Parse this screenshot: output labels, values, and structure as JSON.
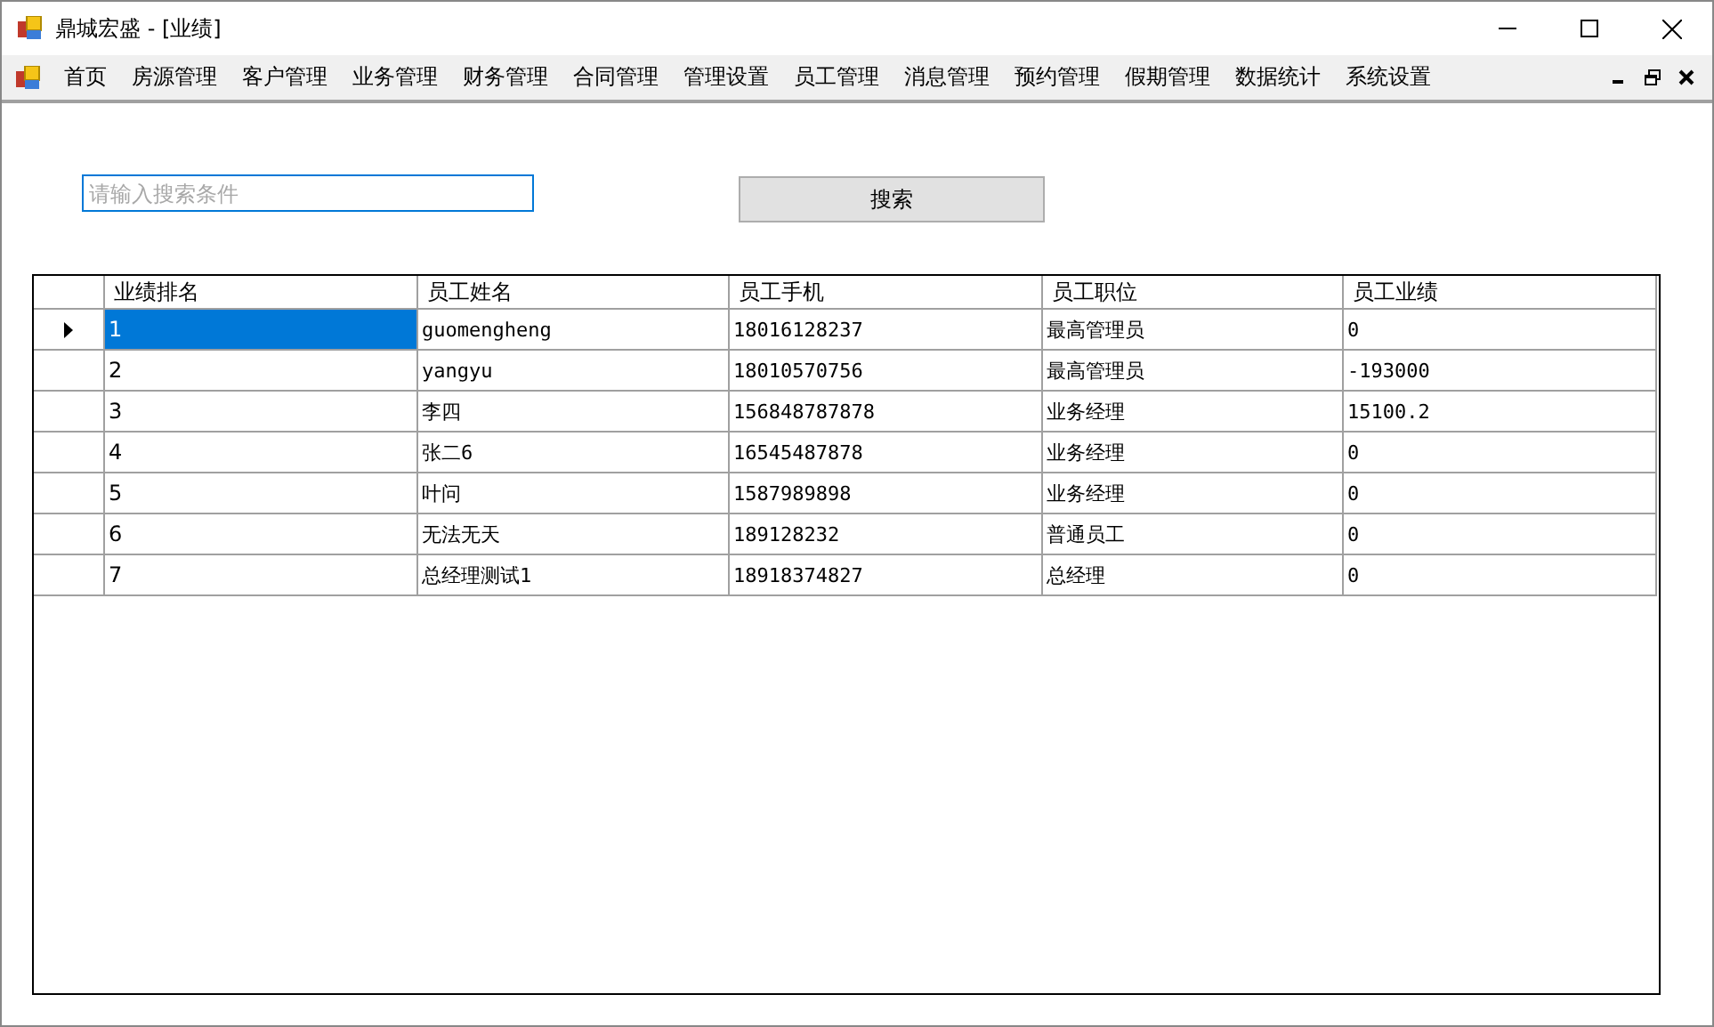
{
  "window": {
    "title": "鼎城宏盛 - [业绩]"
  },
  "menu": [
    "首页",
    "房源管理",
    "客户管理",
    "业务管理",
    "财务管理",
    "合同管理",
    "管理设置",
    "员工管理",
    "消息管理",
    "预约管理",
    "假期管理",
    "数据统计",
    "系统设置"
  ],
  "search": {
    "placeholder": "请输入搜索条件"
  },
  "search_button": "搜索",
  "table": {
    "columns": [
      "业绩排名",
      "员工姓名",
      "员工手机",
      "员工职位",
      "员工业绩"
    ],
    "rows": [
      {
        "selected": true,
        "cells": [
          "1",
          "guomengheng",
          "18016128237",
          "最高管理员",
          "0"
        ]
      },
      {
        "selected": false,
        "cells": [
          "2",
          "yangyu",
          "18010570756",
          "最高管理员",
          "-193000"
        ]
      },
      {
        "selected": false,
        "cells": [
          "3",
          "李四",
          "156848787878",
          "业务经理",
          "15100.2"
        ]
      },
      {
        "selected": false,
        "cells": [
          "4",
          "张二6",
          "16545487878",
          "业务经理",
          "0"
        ]
      },
      {
        "selected": false,
        "cells": [
          "5",
          "叶问",
          "1587989898",
          "业务经理",
          "0"
        ]
      },
      {
        "selected": false,
        "cells": [
          "6",
          "无法无天",
          "189128232",
          "普通员工",
          "0"
        ]
      },
      {
        "selected": false,
        "cells": [
          "7",
          "总经理测试1",
          "18918374827",
          "总经理",
          "0"
        ]
      }
    ]
  }
}
